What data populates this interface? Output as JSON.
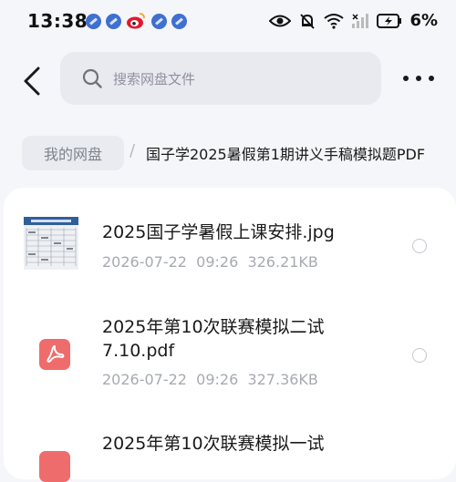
{
  "status_bar": {
    "time": "13:38",
    "battery": "6%"
  },
  "header": {
    "search_placeholder": "搜索网盘文件"
  },
  "breadcrumb": {
    "root": "我的网盘",
    "separator": "/",
    "current": "国子学2025暑假第1期讲义手稿模拟题PDF"
  },
  "files": [
    {
      "name": "2025国子学暑假上课安排.jpg",
      "meta": "2026-07-22  09:26  326.21KB",
      "type": "image"
    },
    {
      "name_line1": "2025年第10次联赛模拟二试",
      "name_line2": "7.10.pdf",
      "meta": "2026-07-22  09:26  327.36KB",
      "type": "pdf"
    },
    {
      "name_line1": "2025年第10次联赛模拟一试",
      "type": "pdf"
    }
  ],
  "colors": {
    "pdf": "#ee6c6b",
    "notif": "#3f6fd1",
    "background": "#f5f6f9"
  }
}
